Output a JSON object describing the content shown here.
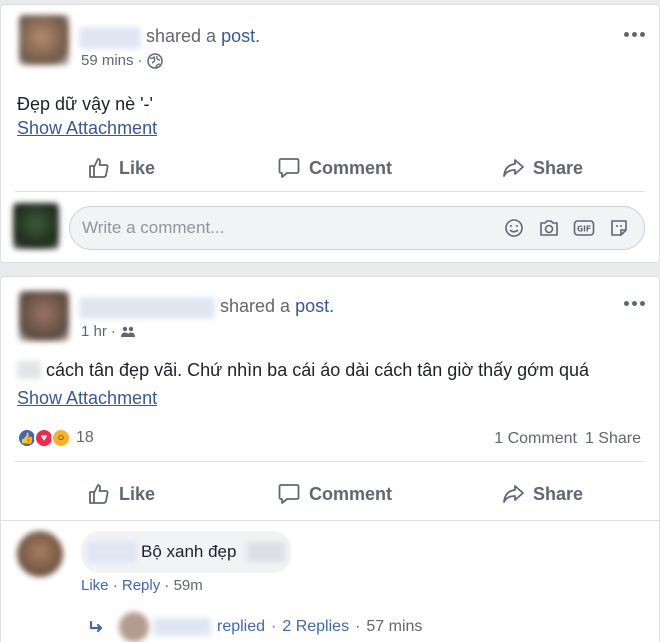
{
  "post1": {
    "shared_prefix": "shared a",
    "shared_link": "post.",
    "time": "59 mins",
    "text": "Đẹp dữ vậy nè '-'",
    "show_attachment": "Show Attachment",
    "actions": {
      "like": "Like",
      "comment": "Comment",
      "share": "Share"
    },
    "comment_placeholder": "Write a comment..."
  },
  "post2": {
    "shared_prefix": "shared a",
    "shared_link": "post.",
    "time": "1 hr",
    "text": "cách tân đẹp vãi. Chứ nhìn ba cái áo dài cách tân giờ thấy gớm quá",
    "show_attachment": "Show Attachment",
    "reaction_count": "18",
    "comment_count": "1 Comment",
    "share_count": "1 Share",
    "actions": {
      "like": "Like",
      "comment": "Comment",
      "share": "Share"
    },
    "comment": {
      "text": "Bộ xanh đẹp",
      "like": "Like",
      "reply": "Reply",
      "time": "59m"
    },
    "replies": {
      "replied": "replied",
      "count": "2 Replies",
      "time": "57 mins"
    }
  },
  "colors": {
    "link": "#365899",
    "like_blue": "#4267b2",
    "love_red": "#f0284a",
    "wow_yellow": "#f7b125"
  }
}
